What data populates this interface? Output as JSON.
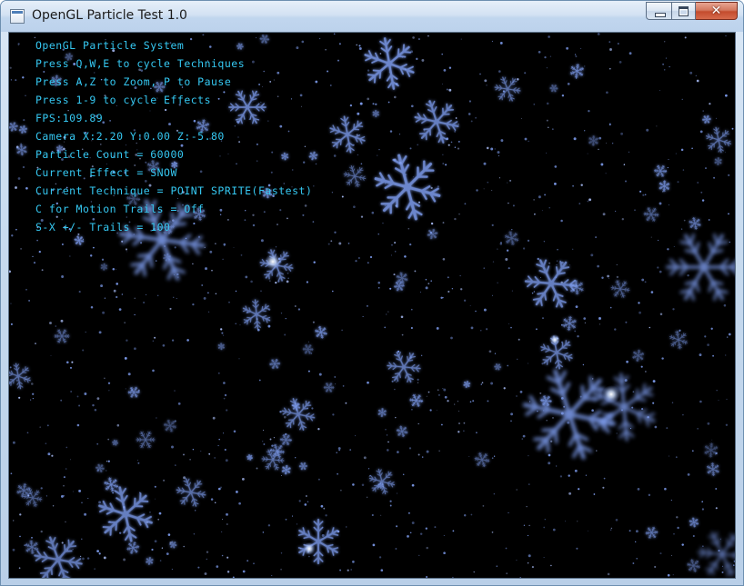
{
  "window": {
    "title": "OpenGL Particle Test 1.0",
    "icon": "app-window-icon",
    "controls": {
      "minimize_icon": "minimize-icon",
      "maximize_icon": "maximize-icon",
      "close_icon": "close-icon",
      "close_glyph": "✕"
    }
  },
  "viewport": {
    "background": "#000000",
    "snow_color": "#7f9ef0",
    "hud_color": "#35c8f2"
  },
  "hud": {
    "lines": [
      "OpenGL Particle System",
      "Press Q,W,E to cycle Techniques",
      "Press A,Z to Zoom, P to Pause",
      "Press 1-9 to cycle Effects",
      "FPS:109.89",
      "Camera X:2.20 Y:0.00 Z:-5.80",
      "Particle Count = 60000",
      "Current Effect = SNOW",
      "Current Technique = POINT SPRITE(Fastest)",
      "C for Motion Trails = Off",
      "S-X +/- Trails = 100"
    ]
  }
}
